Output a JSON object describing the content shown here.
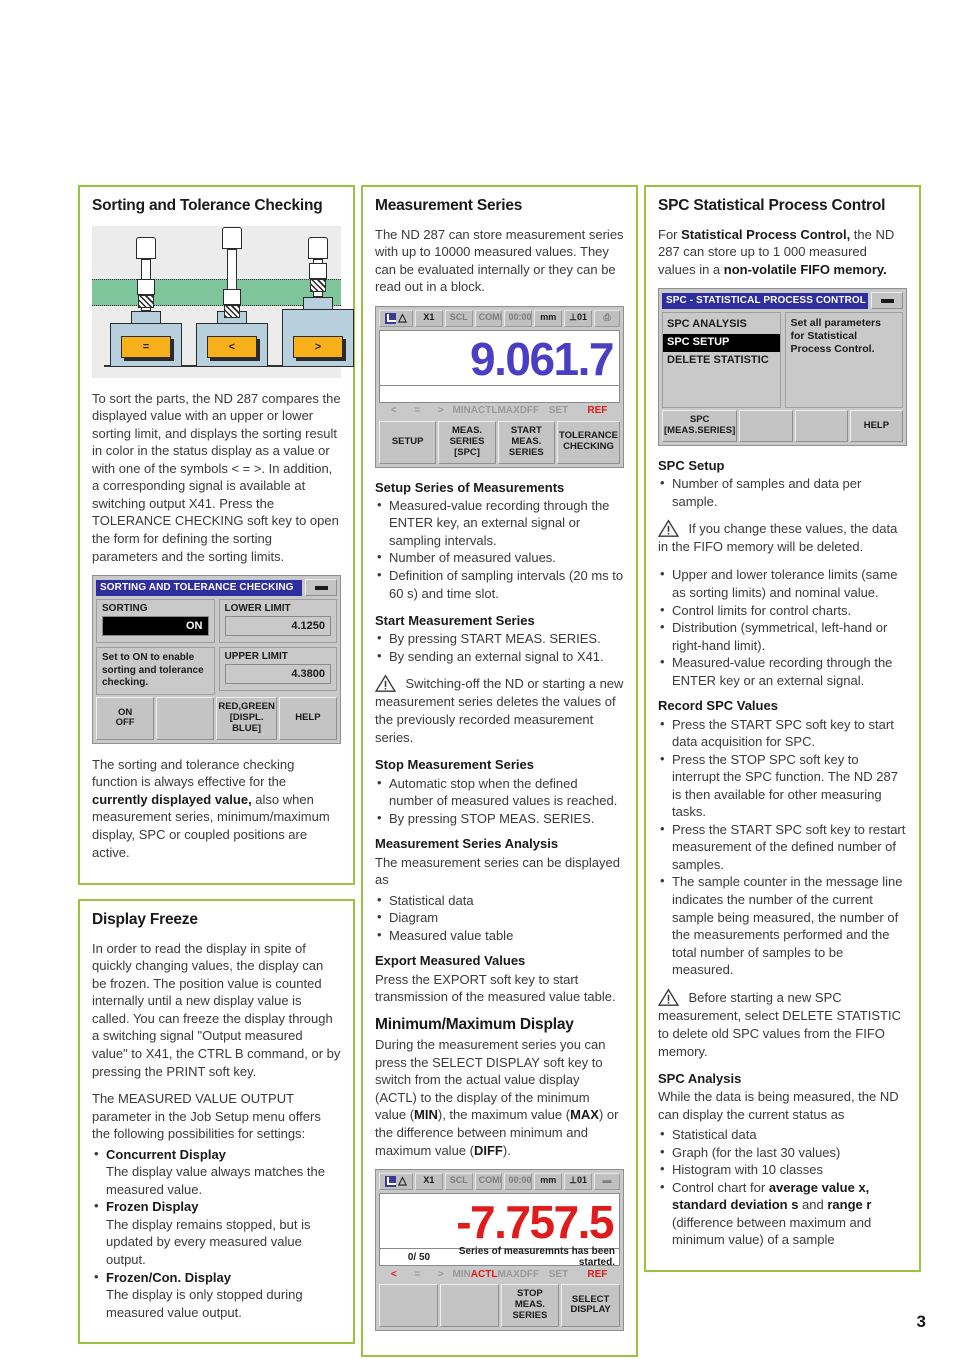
{
  "page": {
    "number": "3",
    "accent_color": "#9ac43c"
  },
  "col_left": {
    "sorting": {
      "title": "Sorting and Tolerance Checking",
      "illustration": {
        "probe_labels": [
          "=",
          "<",
          ">"
        ]
      },
      "body": "To sort the parts, the ND 287 compares the displayed value with an upper or lower sorting limit, and displays the sorting result in color in the status display as a value or with one of the symbols < = >. In addition, a corresponding signal is available at switching output X41. Press the TOLERANCE CHECKING soft key to open the form for defining the sorting parameters and the sorting limits.",
      "dialog": {
        "title": "SORTING AND TOLERANCE CHECKING",
        "sorting_label": "SORTING",
        "sorting_value": "ON",
        "help": "Set to ON to enable sorting and tolerance checking.",
        "lower_limit_label": "LOWER LIMIT",
        "lower_limit_value": "4.1250",
        "upper_limit_label": "UPPER LIMIT",
        "upper_limit_value": "4.3800",
        "softkeys": [
          "ON\nOFF",
          "",
          "RED,GREEN\n[DISPL. BLUE]",
          "HELP"
        ]
      },
      "note_pre": "The sorting and tolerance checking function is always effective for the ",
      "note_bold": "currently displayed value,",
      "note_post": " also when measurement series, minimum/maximum display, SPC or coupled positions are active."
    },
    "display_freeze": {
      "title": "Display Freeze",
      "para1": "In order to read the display in spite of quickly changing values, the display can be frozen. The position value is counted internally until a new display value is called. You can freeze the display through a switching signal \"Output measured value\" to X41, the CTRL B command, or by pressing the PRINT soft key.",
      "para2": "The MEASURED VALUE OUTPUT parameter in the Job Setup menu offers the following possibilities for settings:",
      "items": [
        {
          "bold": "Concurrent Display",
          "text": "The display value always matches the measured value."
        },
        {
          "bold": "Frozen Display",
          "text": "The display remains stopped, but is updated by every measured value output."
        },
        {
          "bold": "Frozen/Con. Display",
          "text": "The display is only stopped during measured value output."
        }
      ]
    }
  },
  "col_mid": {
    "title": "Measurement Series",
    "intro": "The ND 287 can store measurement series with up to 10000 measured values. They can be evaluated internally or they can be read out in a block.",
    "device": {
      "status": [
        "X1",
        "SCL",
        "COMP",
        "00:00",
        "mm",
        "⊥01"
      ],
      "value": "9.061.7",
      "symbols_left": [
        "<",
        "=",
        ">"
      ],
      "symbols_mid": [
        "MIN",
        "ACTL",
        "MAX",
        "DFF"
      ],
      "symbols_right": [
        "SET",
        "REF"
      ],
      "softkeys": [
        "SETUP",
        "MEAS. SERIES\n[SPC]",
        "START\nMEAS. SERIES",
        "TOLERANCE\nCHECKING"
      ]
    },
    "setup_heading": "Setup Series of Measurements",
    "setup_items": [
      "Measured-value recording through the ENTER key, an external signal or sampling intervals.",
      "Number of measured values.",
      "Definition of sampling intervals (20 ms to 60 s) and time slot."
    ],
    "start_heading": "Start Measurement Series",
    "start_items": [
      "By pressing START MEAS. SERIES.",
      "By sending an external signal to X41."
    ],
    "warning": "Switching-off the ND or starting a new measurement series deletes the values of the previously recorded measurement series.",
    "stop_heading": "Stop Measurement Series",
    "stop_items": [
      "Automatic stop when the defined number of measured values is reached.",
      "By pressing STOP MEAS. SERIES."
    ],
    "analysis_heading": "Measurement Series Analysis",
    "analysis_intro": "The measurement series can be displayed as",
    "analysis_items": [
      "Statistical data",
      "Diagram",
      "Measured value table"
    ],
    "export_heading": "Export Measured Values",
    "export_text": "Press the EXPORT soft key to start transmission of the measured value table.",
    "minmax_heading": "Minimum/Maximum Display",
    "minmax_text_1": "During the measurement series you can press the SELECT DISPLAY soft key to switch from the actual value display (ACTL) to the display of the minimum value (",
    "minmax_b1": "MIN",
    "minmax_text_2": "), the maximum value (",
    "minmax_b2": "MAX",
    "minmax_text_3": ") or the difference between minimum and maximum value (",
    "minmax_b3": "DIFF",
    "minmax_text_4": ").",
    "device2": {
      "status": [
        "X1",
        "SCL",
        "COMP",
        "00:00",
        "mm",
        "⊥01"
      ],
      "value": "-7.757.5",
      "counter": "0/ 50",
      "message": "Series of measuremnts has been started.",
      "symbols_left": [
        "<",
        "=",
        ">"
      ],
      "symbols_mid": [
        "MIN",
        "ACTL",
        "MAX",
        "DFF"
      ],
      "symbols_right": [
        "SET",
        "REF"
      ],
      "softkeys": [
        "",
        "",
        "STOP\nMEAS. SERIES",
        "SELECT\nDISPLAY"
      ]
    }
  },
  "col_right": {
    "title": "SPC Statistical Process Control",
    "intro_1": "For ",
    "intro_b1": "Statistical Process Control,",
    "intro_2": " the ND 287 can store up to 1 000 measured values in a ",
    "intro_b2": "non-volatile FIFO memory.",
    "dialog": {
      "title": "SPC - STATISTICAL PROCESS CONTROL",
      "menu": [
        "SPC ANALYSIS",
        "SPC SETUP",
        "DELETE STATISTIC"
      ],
      "selected_index": 1,
      "description": "Set all parameters for Statistical Process Control.",
      "softkeys": [
        "SPC\n[MEAS.SERIES]",
        "",
        "",
        "HELP"
      ]
    },
    "setup_heading": "SPC Setup",
    "setup_items_1": [
      "Number of samples and data per sample."
    ],
    "warning_1": "If you change these values, the data in the FIFO memory will be deleted.",
    "setup_items_2": [
      "Upper and lower tolerance limits (same as sorting limits) and nominal value.",
      "Control limits for control charts.",
      "Distribution (symmetrical, left-hand or right-hand limit).",
      "Measured-value recording through the ENTER key or an external signal."
    ],
    "record_heading": "Record SPC Values",
    "record_items": [
      "Press the START SPC soft key to start data acquisition for SPC.",
      "Press the STOP SPC soft key to interrupt the SPC function. The ND 287 is then available for other measuring tasks.",
      "Press the START SPC soft key to restart measurement of the defined number of samples.",
      "The sample counter in the message line indicates the number of the current sample being measured, the number of the measurements performed and the total number of samples to be measured."
    ],
    "warning_2": "Before starting a new SPC measurement, select DELETE STATISTIC to delete old SPC values from the FIFO memory.",
    "analysis_heading": "SPC Analysis",
    "analysis_intro": "While the data is being measured, the ND can display the current status as",
    "analysis_items": [
      "Statistical data",
      "Graph (for the last 30 values)",
      "Histogram with 10 classes"
    ],
    "analysis_last_1": "Control chart for ",
    "analysis_last_b1": "average value x,",
    "analysis_last_2": " ",
    "analysis_last_b2": "standard deviation s",
    "analysis_last_3": " and ",
    "analysis_last_b3": "range r",
    "analysis_last_4": " (difference between maximum and minimum value) of a sample"
  }
}
